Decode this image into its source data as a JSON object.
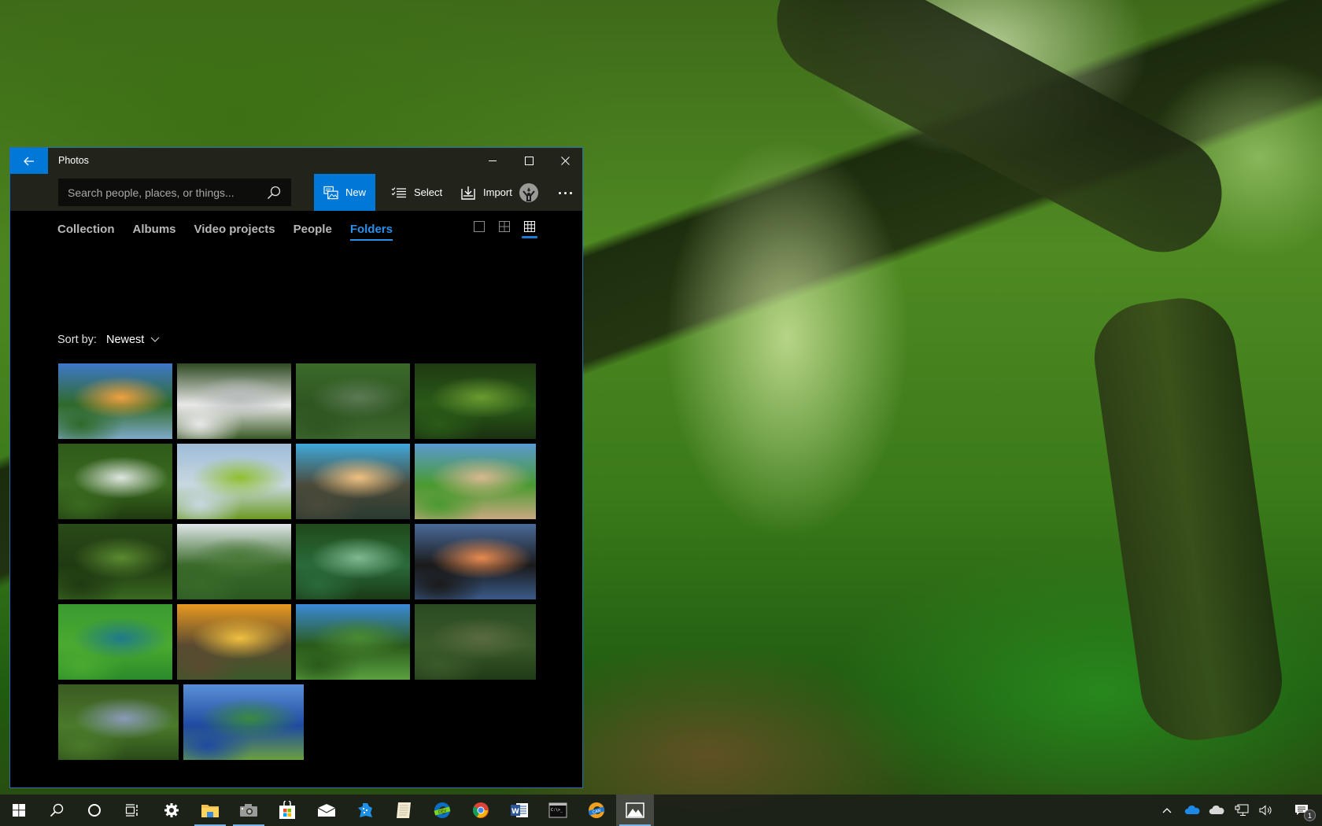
{
  "desktop": {
    "wallpaper": "forest-wallpaper"
  },
  "window": {
    "title": "Photos",
    "accent": "#0078d7",
    "search": {
      "placeholder": "Search people, places, or things...",
      "value": ""
    },
    "toolbar": {
      "new_label": "New",
      "select_label": "Select",
      "import_label": "Import"
    },
    "tabs": [
      {
        "label": "Collection",
        "active": false
      },
      {
        "label": "Albums",
        "active": false
      },
      {
        "label": "Video projects",
        "active": false
      },
      {
        "label": "People",
        "active": false
      },
      {
        "label": "Folders",
        "active": true
      }
    ],
    "view_modes": [
      {
        "name": "large",
        "active": false
      },
      {
        "name": "medium",
        "active": false
      },
      {
        "name": "small",
        "active": true
      }
    ],
    "sort": {
      "label": "Sort by:",
      "value": "Newest"
    },
    "photos": [
      {
        "name": "sunset-river",
        "colors": [
          "#3f78c8",
          "#f0a040",
          "#2f6a2a",
          "#7fa9c8"
        ]
      },
      {
        "name": "waterfall-mist",
        "colors": [
          "#2f4a22",
          "#b8bcbc",
          "#e8e8e8",
          "#3a5a25"
        ]
      },
      {
        "name": "winding-river-aerial",
        "colors": [
          "#3b6a2a",
          "#5a7a55",
          "#2f5520",
          "#3f6a30"
        ]
      },
      {
        "name": "jungle-green",
        "colors": [
          "#1f3a12",
          "#6a9a30",
          "#2a5a18",
          "#1a3010"
        ]
      },
      {
        "name": "jungle-waterfall",
        "colors": [
          "#2f5a1a",
          "#dfe6e0",
          "#3a6a20",
          "#1f3a10"
        ]
      },
      {
        "name": "lily-pads",
        "colors": [
          "#9fbcd8",
          "#8fbf30",
          "#c8d8e0",
          "#6a9a20"
        ]
      },
      {
        "name": "lake-clouds",
        "colors": [
          "#3fa8d8",
          "#f0c080",
          "#4a4a3a",
          "#2a3a30"
        ]
      },
      {
        "name": "sand-river-bank",
        "colors": [
          "#5a9ad0",
          "#d8b890",
          "#4a9a30",
          "#c8a880"
        ]
      },
      {
        "name": "jungle-path",
        "colors": [
          "#2a4a18",
          "#5a8a30",
          "#1f3a12",
          "#3a6a20"
        ]
      },
      {
        "name": "lily-pond-hut",
        "colors": [
          "#dfe6e8",
          "#4a7a3a",
          "#3a6a2a",
          "#2a5a20"
        ]
      },
      {
        "name": "sun-rays-forest",
        "colors": [
          "#1f4a1a",
          "#7fb890",
          "#2a6a3a",
          "#1a3a15"
        ]
      },
      {
        "name": "river-sunset-reflection",
        "colors": [
          "#4a6a9a",
          "#e88a50",
          "#1a1a1a",
          "#3a5a8a"
        ]
      },
      {
        "name": "treetops-aerial",
        "colors": [
          "#3a9a30",
          "#1f7a8a",
          "#4aaa30",
          "#2a8a2a"
        ]
      },
      {
        "name": "golden-canopy",
        "colors": [
          "#e89a20",
          "#f0c040",
          "#5a4a30",
          "#3a5a2a"
        ]
      },
      {
        "name": "canopy-walkway",
        "colors": [
          "#3a8ad8",
          "#4a8a30",
          "#2a5a1a",
          "#5aa040"
        ]
      },
      {
        "name": "river-bend-aerial",
        "colors": [
          "#2a4a22",
          "#5a6a40",
          "#3a5a2a",
          "#1f3a18"
        ]
      },
      {
        "name": "dark-river-aerial",
        "colors": [
          "#3a5a22",
          "#8a9ab8",
          "#4a7a2a",
          "#2a4a18"
        ]
      },
      {
        "name": "amazon-river-aerial",
        "colors": [
          "#5a90d8",
          "#3a8a40",
          "#1f4aa0",
          "#6aa040"
        ]
      }
    ]
  },
  "taskbar": {
    "items": [
      {
        "name": "start",
        "icon": "windows-logo-icon"
      },
      {
        "name": "search",
        "icon": "search-icon"
      },
      {
        "name": "cortana",
        "icon": "cortana-circle-icon"
      },
      {
        "name": "task-view",
        "icon": "task-view-icon"
      },
      {
        "name": "settings",
        "icon": "gear-icon"
      },
      {
        "name": "file-explorer",
        "icon": "folder-icon",
        "running": true
      },
      {
        "name": "camera",
        "icon": "camera-icon"
      },
      {
        "name": "microsoft-store",
        "icon": "store-bag-icon"
      },
      {
        "name": "mail",
        "icon": "mail-icon"
      },
      {
        "name": "app-blue",
        "icon": "blue-app-icon"
      },
      {
        "name": "notepad",
        "icon": "notepad-icon"
      },
      {
        "name": "edge-dev",
        "icon": "edge-dev-icon",
        "badge": "DEV"
      },
      {
        "name": "chrome",
        "icon": "chrome-icon"
      },
      {
        "name": "word",
        "icon": "word-icon",
        "letter": "W"
      },
      {
        "name": "command-prompt",
        "icon": "cmd-icon",
        "text": "C:\\>_"
      },
      {
        "name": "edge-canary",
        "icon": "edge-canary-icon",
        "badge": "CAN"
      },
      {
        "name": "photos",
        "icon": "photos-icon",
        "active": true
      }
    ],
    "tray": {
      "notification_count": "1"
    }
  }
}
